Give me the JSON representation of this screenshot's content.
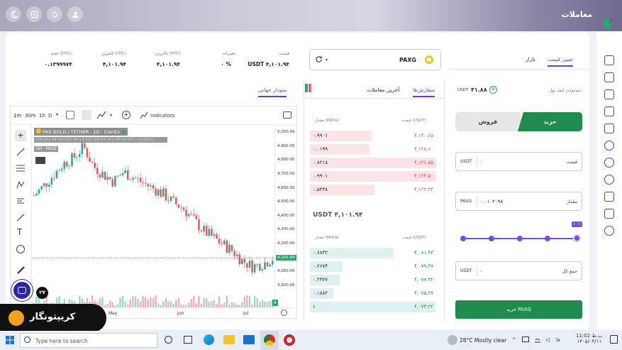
{
  "header": {
    "title": "معاملات"
  },
  "market": {
    "pair": "PAXG"
  },
  "stats": [
    {
      "label": "قیمت",
      "value": "USDT ۴,۱۰۱.۹۴"
    },
    {
      "label": "تغییرات",
      "value": "۰ %"
    },
    {
      "label": "بالاترین (۲۴h):",
      "value": "۴,۱۰۱.۹۴"
    },
    {
      "label": "کمترین (۲۴h):",
      "value": "۴,۱۰۱.۹۴"
    },
    {
      "label": "حجم (۲۴h):",
      "value": "۰.۱۳۹۹۹۷۴"
    }
  ],
  "tabs": {
    "global_chart": "نمودار جهانی",
    "orders": "سفارش‌ها",
    "last_trades": "آخرین معاملات",
    "set_price": "تعیین قیمت",
    "market": "بازار"
  },
  "chart": {
    "timeframes": [
      "1m",
      "30m",
      "1h",
      "D"
    ],
    "indicators_label": "Indicators",
    "legend_title": "PAX GOLD / TETHER · 1D · CoinEx",
    "legend_ohlc": "O4,101.94 H4,101.94 L4,101.94 C4,101.94 +0.00 (+0.00%)",
    "vol_label": "Vol · PAXG",
    "y_ticks": [
      "5,000.00",
      "4,900.00",
      "4,800.00",
      "4,700.00",
      "4,600.00",
      "4,500.00",
      "4,400.00",
      "4,300.00",
      "4,200.00",
      "4,101.94",
      "4,000.00",
      "3,900.00"
    ],
    "x_ticks": [
      "May",
      "Jun",
      "Jul"
    ],
    "last_price": "4,101.94",
    "vol_badge": "6",
    "tv_badge": "۲۷"
  },
  "chart_data": {
    "type": "candlestick",
    "title": "PAX GOLD / TETHER · 1D · CoinEx",
    "ylim": [
      3900,
      5000
    ],
    "last": 4101.94
  },
  "orderbook": {
    "head_price": "قیمت (USDT)",
    "head_amount": "مقدار (PAXG)",
    "asks": [
      {
        "price": "۴,۱۳۰.۶۵",
        "amount": "۰.۹۹۰۱",
        "w": 0.48
      },
      {
        "price": "۴,۱۲۸.۶۰",
        "amount": "۰.۰۱۹۹",
        "w": 0.46
      },
      {
        "price": "۴,۱۲۶.۵۵",
        "amount": "۰.۸۲۱۸",
        "w": 0.98
      },
      {
        "price": "۴,۱۲۴.۵۰",
        "amount": "۰.۹۹۰۱",
        "w": 0.98
      },
      {
        "price": "۴,۱۲۲.۴۴",
        "amount": "۰.۵۴۳۸",
        "w": 0.5
      }
    ],
    "mid": "USDT ۴,۱۰۱.۹۴",
    "bids": [
      {
        "price": "۴,۰۸۱.۴۳",
        "amount": "۰.۶۸۳۲",
        "w": 0.65
      },
      {
        "price": "۴,۰۷۹.۳۷",
        "amount": "۰.۲۶۷۴",
        "w": 0.25
      },
      {
        "price": "۴,۰۷۷.۳۲",
        "amount": "۰.۲۳۷۷",
        "w": 0.23
      },
      {
        "price": "۴,۰۷۵.۲۷",
        "amount": "۰.۱۸۸۲",
        "w": 0.18
      },
      {
        "price": "۴,۰۷۳.۲۲",
        "amount": "۱",
        "w": 0.97
      }
    ]
  },
  "trade": {
    "wallet_label": "موجودی کیف پول:",
    "wallet_value": "۴۱.۸۸",
    "wallet_unit": "USDT",
    "buy": "خرید",
    "sell": "فروش",
    "price_label": "قیمت",
    "price_unit": "USDT",
    "price_value": "۰",
    "amount_label": "مقدار",
    "amount_unit": "PAXG",
    "amount_value": "۰.۰۱۰۲۰۹۸",
    "slider_badge": "۱۰۰٪",
    "slider_value": 1.0,
    "total_label": "جمع کل",
    "total_unit": "USDT",
    "total_value": "۰",
    "submit": "خرید PAXG"
  },
  "logo_text": "کریپتونگار",
  "taskbar": {
    "search": "Type here to search",
    "weather": "28°C Mostly clear",
    "lang": "فا",
    "time": "11:02 ب.ظ",
    "date": "۱۴۰۵/۰۴/۱۱"
  },
  "colors": {
    "accent": "#6a3fc7",
    "buy": "#1f8b4c",
    "sell": "#e26b7a",
    "ask_bg": "#fbe3e6",
    "bid_bg": "#dff2f1"
  }
}
